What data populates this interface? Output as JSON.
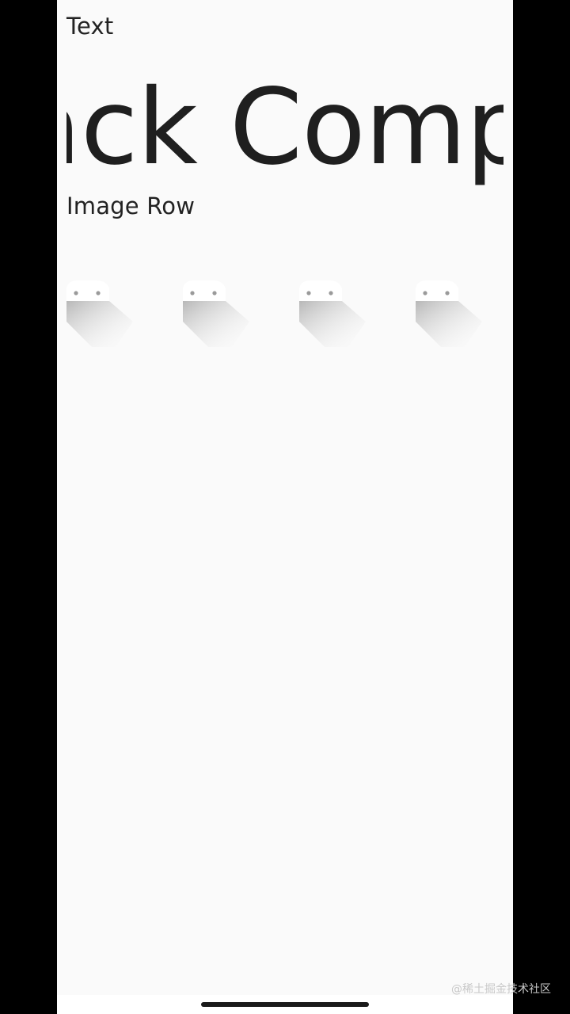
{
  "sections": {
    "text_label": "Text",
    "image_row_label": "Image Row"
  },
  "marquee": {
    "visible_text": "ack Comp"
  },
  "image_row": {
    "icons": [
      "android-icon",
      "android-icon",
      "android-icon",
      "android-icon"
    ]
  },
  "watermark": "@稀土掘金技术社区",
  "colors": {
    "background": "#fafafa",
    "text": "#222222",
    "frame": "#000000"
  }
}
